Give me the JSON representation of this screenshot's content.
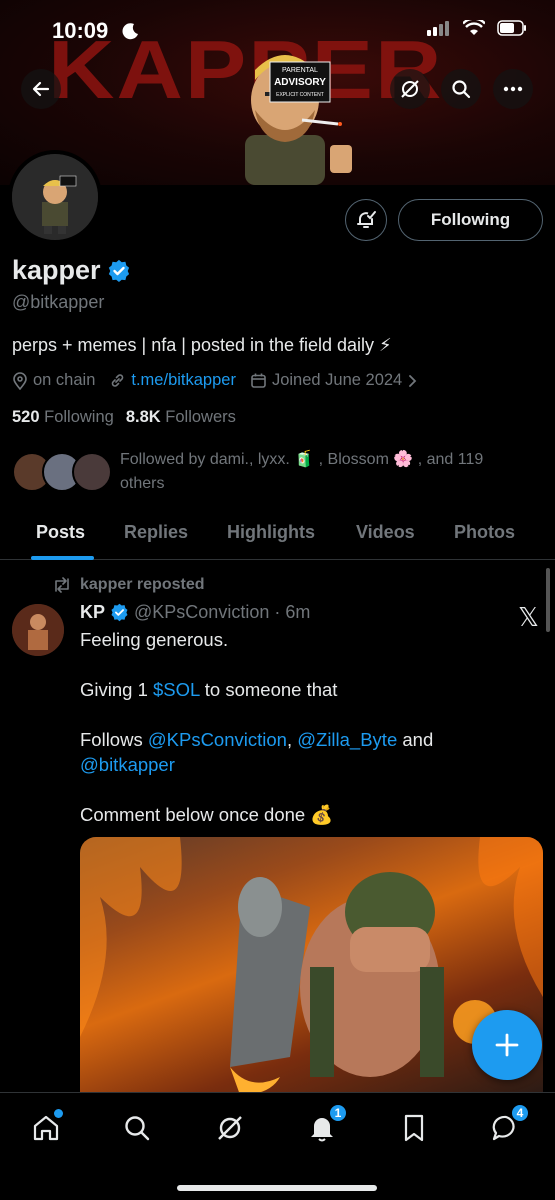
{
  "status_bar": {
    "time": "10:09"
  },
  "banner": {
    "text": "KAPPER",
    "advisory": [
      "PARENTAL",
      "ADVISORY",
      "EXPLICIT CONTENT"
    ]
  },
  "profile": {
    "name": "kapper",
    "handle": "@bitkapper",
    "bio": "perps + memes | nfa | posted in the field daily ⚡",
    "location": "on chain",
    "link": "t.me/bitkapper",
    "joined": "Joined June 2024",
    "following_count": "520",
    "following_label": "Following",
    "followers_count": "8.8K",
    "followers_label": "Followers",
    "follow_button": "Following",
    "followed_by": "Followed by dami., lyxx. 🧃 , Blossom 🌸 , and 119 others"
  },
  "tabs": [
    {
      "label": "Posts"
    },
    {
      "label": "Replies"
    },
    {
      "label": "Highlights"
    },
    {
      "label": "Videos"
    },
    {
      "label": "Photos"
    }
  ],
  "post": {
    "repost_label": "kapper reposted",
    "author_name": "KP",
    "author_handle": "@KPsConviction",
    "dot": "·",
    "time": "6m",
    "line1": "Feeling generous.",
    "line2_a": "Giving 1 ",
    "line2_link": "$SOL",
    "line2_b": " to someone that",
    "line3_a": "Follows ",
    "mention1": "@KPsConviction",
    "comma": ", ",
    "mention2": "@Zilla_Byte",
    "and": " and",
    "mention3": "@bitkapper",
    "line4": "Comment below once done 💰",
    "platform_mark": "𝕏"
  },
  "fab": {
    "label": "+"
  },
  "nav": {
    "notifications_badge": "1",
    "messages_badge": "4"
  },
  "colors": {
    "accent": "#1d9bf0",
    "muted": "#71767b",
    "text": "#e7e9ea",
    "border": "#2f3336"
  }
}
